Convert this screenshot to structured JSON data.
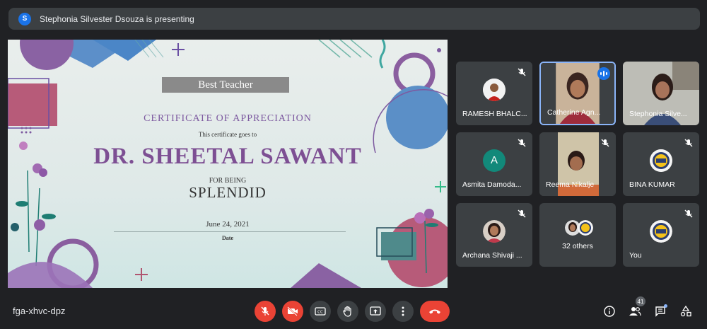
{
  "banner": {
    "avatar_letter": "S",
    "text": "Stephonia Silvester Dsouza is presenting"
  },
  "certificate": {
    "badge": "Best Teacher",
    "heading": "CERTIFICATE OF APPRECIATION",
    "goes_to": "This certificate goes to",
    "name": "DR. SHEETAL SAWANT",
    "for_being": "FOR BEING",
    "quality": "SPLENDID",
    "date": "June 24, 2021",
    "date_label": "Date"
  },
  "participants": [
    {
      "name": "RAMESH BHALC...",
      "muted": true
    },
    {
      "name": "Catherine Agn...",
      "speaking": true
    },
    {
      "name": "Stephonia Silve..."
    },
    {
      "name": "Asmita Damoda...",
      "avatar_letter": "A",
      "muted": true
    },
    {
      "name": "Reema Nikalje",
      "muted": true
    },
    {
      "name": "BINA KUMAR",
      "muted": true
    },
    {
      "name": "Archana Shivaji ...",
      "muted": true
    },
    {
      "name": "32 others"
    },
    {
      "name": "You",
      "muted": true
    }
  ],
  "footer": {
    "meeting_code": "fga-xhvc-dpz",
    "participant_count": "41"
  },
  "colors": {
    "background": "#202124",
    "tile": "#3c4043",
    "danger": "#ea4335",
    "accent": "#1a73e8",
    "speaking_border": "#8ab4f8"
  },
  "icons": [
    "mic-off-icon",
    "camera-off-icon",
    "captions-icon",
    "raise-hand-icon",
    "present-icon",
    "more-options-icon",
    "end-call-icon",
    "info-icon",
    "people-icon",
    "chat-icon",
    "activities-icon"
  ]
}
